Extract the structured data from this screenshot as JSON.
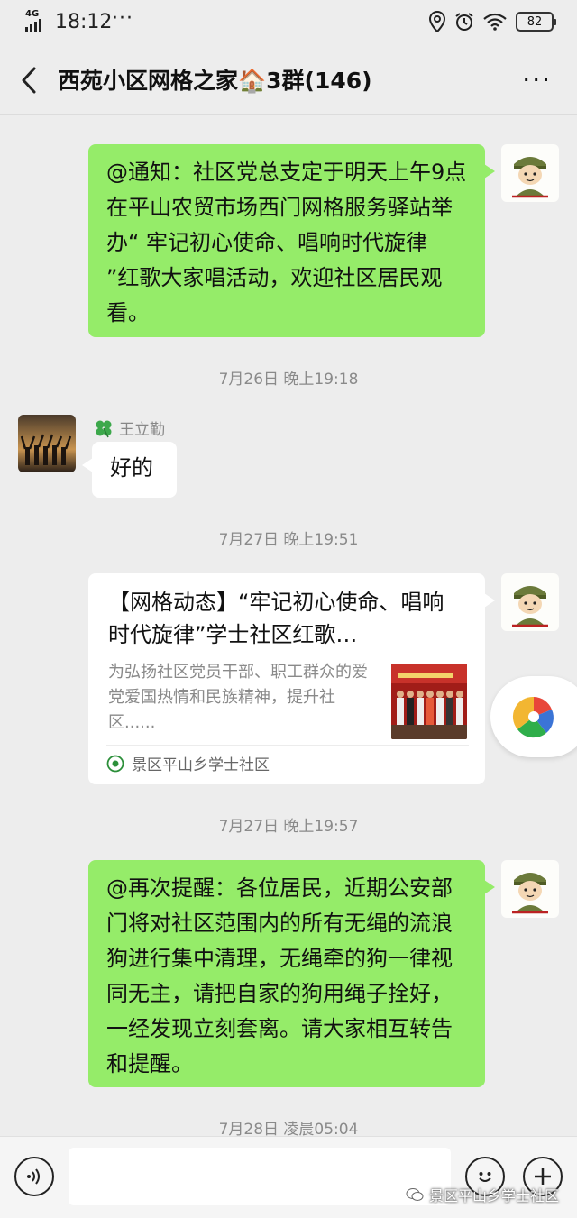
{
  "status_bar": {
    "network": "4G",
    "time": "18:12",
    "dots": "···",
    "battery": "82"
  },
  "header": {
    "title": "西苑小区网格之家🏠3群(146)"
  },
  "messages": {
    "notice": {
      "text": "@通知：社区党总支定于明天上午9点在平山农贸市场西门网格服务驿站举办“ 牢记初心使命、唱响时代旋律 ”红歌大家唱活动，欢迎社区居民观看。"
    },
    "ts1": "7月26日 晚上19:18",
    "reply": {
      "sender": "王立勤",
      "text": "好的"
    },
    "ts2": "7月27日 晚上19:51",
    "article": {
      "title": "【网格动态】“牢记初心使命、唱响时代旋律”学士社区红歌…",
      "desc": "为弘扬社区党员干部、职工群众的爱党爱国热情和民族精神，提升社区......",
      "source": "景区平山乡学士社区"
    },
    "ts3": "7月27日 晚上19:57",
    "reminder": {
      "text": "@再次提醒：各位居民，近期公安部门将对社区范围内的所有无绳的流浪狗进行集中清理，无绳牵的狗一律视同无主，请把自家的狗用绳子拴好，一经发现立刻套离。请大家相互转告和提醒。"
    },
    "ts4": "7月28日 凌晨05:04"
  },
  "input_bar": {
    "watermark": "景区平山乡学士社区"
  },
  "colors": {
    "bubble_green": "#95ec69",
    "background": "#ededed"
  }
}
